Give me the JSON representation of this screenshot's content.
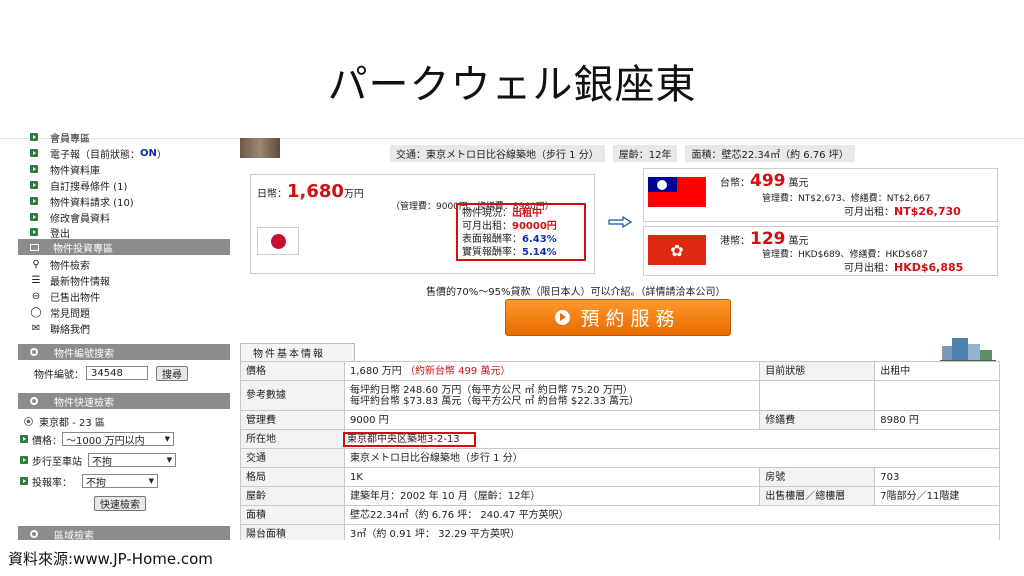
{
  "slide": {
    "title": "パークウェル銀座東",
    "source": "資料來源:www.JP-Home.com"
  },
  "sidebar": {
    "items_top": [
      {
        "label": "會員專區",
        "status": ""
      },
      {
        "label": "電子報（目前狀態：",
        "status": "ON",
        "suffix": "）"
      },
      {
        "label": "物件資料庫"
      },
      {
        "label": "自訂搜尋條件 (1)"
      },
      {
        "label": "物件資料請求 (10)"
      },
      {
        "label": "修改會員資料"
      },
      {
        "label": "登出"
      }
    ],
    "invest_header": "物件投資專區",
    "invest_items": [
      {
        "label": "物件檢索",
        "icon": "search-icon"
      },
      {
        "label": "最新物件情報",
        "icon": "rss-icon"
      },
      {
        "label": "已售出物件",
        "icon": "minus-circle-icon"
      },
      {
        "label": "常見問題",
        "icon": "speech-bubble-icon"
      },
      {
        "label": "聯絡我們",
        "icon": "envelope-icon"
      }
    ],
    "number_search": {
      "header": "物件編號搜索",
      "label": "物件編號：",
      "value": "34548",
      "button": "搜尋"
    },
    "quick_search": {
      "header": "物件快速檢索",
      "region": "東京都 - 23 區",
      "price_label": "價格：",
      "price_value": "～1000 万円以内",
      "walk_label": "步行至車站",
      "walk_value": "不拘",
      "yield_label": "投報率：",
      "yield_value": "不拘",
      "button": "快速檢索"
    },
    "area_search": {
      "header": "區域檢索"
    }
  },
  "infobar": {
    "transport": "交通：東京メトロ日比谷線築地（步行 1 分）",
    "age": "屋齡：12年",
    "area": "面積：壁芯22.34㎡（約 6.76 坪）"
  },
  "jp": {
    "label": "日幣：",
    "price": "1,680",
    "unit": "万円",
    "fees": "（管理費：9000円、修繕費：8980円）",
    "status_lines": [
      {
        "label": "物件現況：",
        "value": "出租中",
        "color": "red"
      },
      {
        "label": "可月出租：",
        "value": "90000円",
        "color": "red"
      },
      {
        "label": "表面報酬率：",
        "value": "6.43%",
        "color": "blue"
      },
      {
        "label": "實質報酬率：",
        "value": "5.14%",
        "color": "blue"
      }
    ]
  },
  "tw": {
    "label": "台幣：",
    "price": "499",
    "unit": "萬元",
    "fees": "管理費：NT$2,673、修繕費：NT$2,667",
    "rent_label": "可月出租：",
    "rent": "NT$26,730"
  },
  "hk": {
    "label": "港幣：",
    "price": "129",
    "unit": "萬元",
    "fees": "管理費：HKD$689、修繕費：HKD$687",
    "rent_label": "可月出租：",
    "rent": "HKD$6,885"
  },
  "loan_note": "售價的70%〜95%貸款（限日本人）可以介紹。（詳情請洽本公司）",
  "reserve_button": "預約服務",
  "details": {
    "tab": "物件基本情報",
    "rows": [
      {
        "l1": "價格",
        "v1": "1,680 万円",
        "v1b": "（約新台幣 499 萬元）",
        "l2": "目前狀態",
        "v2": "出租中"
      },
      {
        "l1": "參考數據",
        "v1": "每坪約日幣 248.60 万円（每平方公尺 ㎡ 約日幣 75.20 万円）",
        "v1c": "每坪約台幣 $73.83 萬元（每平方公尺 ㎡ 約台幣 $22.33 萬元）",
        "l2": "",
        "v2": ""
      },
      {
        "l1": "管理費",
        "v1": "9000 円",
        "l2": "修繕費",
        "v2": "8980 円"
      },
      {
        "l1": "所在地",
        "v1": "東京都中央区築地3-2-13",
        "l2": "",
        "v2": ""
      },
      {
        "l1": "交通",
        "v1": "東京メトロ日比谷線築地（步行 1 分）",
        "l2": "",
        "v2": ""
      },
      {
        "l1": "格局",
        "v1": "1K",
        "l2": "房號",
        "v2": "703"
      },
      {
        "l1": "屋齡",
        "v1": "建築年月：2002 年 10 月（屋齡：12年）",
        "l2": "出售樓層／總樓層",
        "v2": "7階部分／11階建"
      },
      {
        "l1": "面積",
        "v1": "壁芯22.34㎡（約 6.76 坪： 240.47 平方英呎）",
        "l2": "",
        "v2": ""
      },
      {
        "l1": "陽台面積",
        "v1": "3㎡（約 0.91 坪： 32.29 平方英呎）",
        "l2": "",
        "v2": ""
      }
    ]
  }
}
